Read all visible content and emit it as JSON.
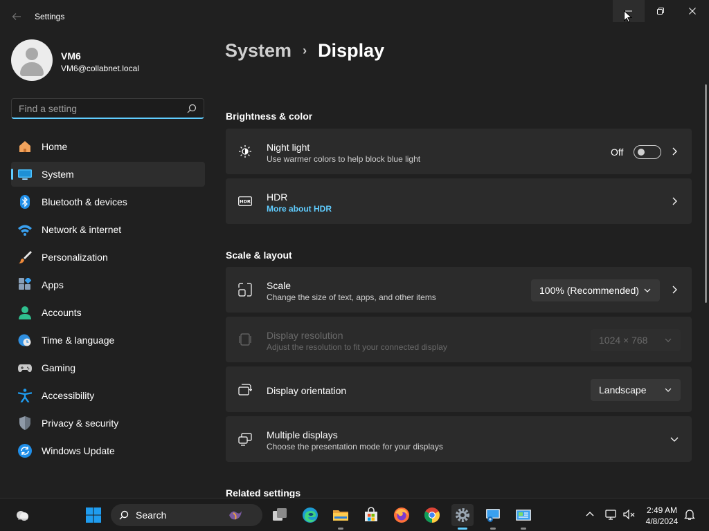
{
  "window": {
    "title": "Settings",
    "back_icon": "arrow-left-icon",
    "controls": [
      "minimize-icon",
      "maximize-icon",
      "close-icon"
    ]
  },
  "user": {
    "name": "VM6",
    "email": "VM6@collabnet.local"
  },
  "search": {
    "placeholder": "Find a setting",
    "value": ""
  },
  "nav": {
    "selected": "System",
    "items": [
      {
        "label": "Home",
        "icon": "home-icon"
      },
      {
        "label": "System",
        "icon": "monitor-icon"
      },
      {
        "label": "Bluetooth & devices",
        "icon": "bluetooth-icon"
      },
      {
        "label": "Network & internet",
        "icon": "wifi-icon"
      },
      {
        "label": "Personalization",
        "icon": "brush-icon"
      },
      {
        "label": "Apps",
        "icon": "apps-icon"
      },
      {
        "label": "Accounts",
        "icon": "person-icon"
      },
      {
        "label": "Time & language",
        "icon": "globe-clock-icon"
      },
      {
        "label": "Gaming",
        "icon": "gamepad-icon"
      },
      {
        "label": "Accessibility",
        "icon": "accessibility-icon"
      },
      {
        "label": "Privacy & security",
        "icon": "shield-icon"
      },
      {
        "label": "Windows Update",
        "icon": "update-icon"
      }
    ]
  },
  "breadcrumb": {
    "parent": "System",
    "separator": "›",
    "current": "Display"
  },
  "sections": {
    "brightness_color": "Brightness & color",
    "scale_layout": "Scale & layout",
    "related": "Related settings"
  },
  "cards": {
    "night_light": {
      "title": "Night light",
      "desc": "Use warmer colors to help block blue light",
      "toggle_label": "Off",
      "toggle_on": false,
      "icon": "brightness-icon"
    },
    "hdr": {
      "title": "HDR",
      "link": "More about HDR",
      "icon": "hdr-icon"
    },
    "scale": {
      "title": "Scale",
      "desc": "Change the size of text, apps, and other items",
      "value": "100% (Recommended)",
      "icon": "scale-icon"
    },
    "resolution": {
      "title": "Display resolution",
      "desc": "Adjust the resolution to fit your connected display",
      "value": "1024 × 768",
      "disabled": true,
      "icon": "resolution-icon"
    },
    "orientation": {
      "title": "Display orientation",
      "value": "Landscape",
      "icon": "orientation-icon"
    },
    "multiple": {
      "title": "Multiple displays",
      "desc": "Choose the presentation mode for your displays",
      "icon": "multiple-displays-icon"
    }
  },
  "taskbar": {
    "search_label": "Search",
    "apps": [
      "widgets-icon",
      "start-icon",
      "task-view-icon",
      "edge-icon",
      "file-explorer-icon",
      "store-icon",
      "firefox-icon",
      "chrome-icon",
      "settings-icon",
      "remote-desktop-icon",
      "control-panel-icon"
    ],
    "tray": [
      "chevron-up-icon",
      "network-icon",
      "volume-muted-icon",
      "notification-bell-icon"
    ],
    "time": "2:49 AM",
    "date": "4/8/2024"
  },
  "colors": {
    "accent": "#60cdff",
    "background": "#202020",
    "card": "#2b2b2b"
  }
}
